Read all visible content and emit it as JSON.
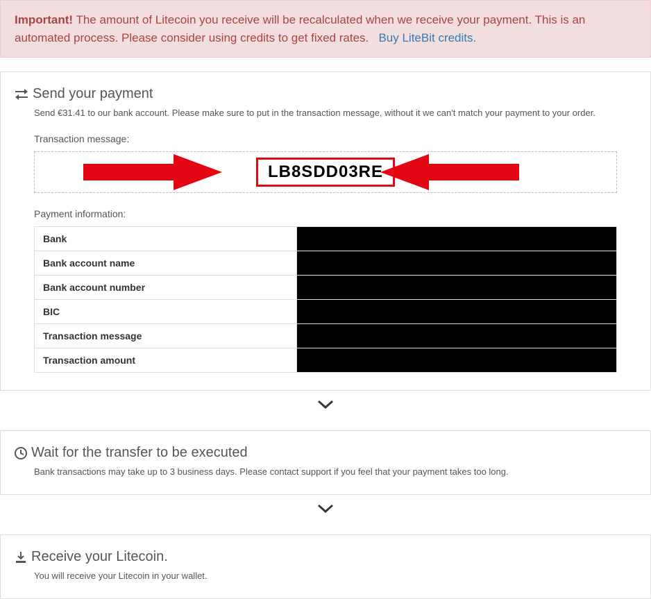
{
  "alert": {
    "strong": "Important!",
    "text": "The amount of Litecoin you receive will be recalculated when we receive your payment. This is an automated process. Please consider using credits to get fixed rates.",
    "link": "Buy LiteBit credits."
  },
  "section1": {
    "heading": "Send your payment",
    "sub": "Send €31.41 to our bank account. Please make sure to put in the transaction message, without it we can't match your payment to your order.",
    "txLabel": "Transaction message:",
    "txCode": "LB8SDD03RE",
    "payInfoLabel": "Payment information:",
    "rows": [
      {
        "key": "Bank",
        "val": ""
      },
      {
        "key": "Bank account name",
        "val": ""
      },
      {
        "key": "Bank account number",
        "val": ""
      },
      {
        "key": "BIC",
        "val": ""
      },
      {
        "key": "Transaction message",
        "val": ""
      },
      {
        "key": "Transaction amount",
        "val": ""
      }
    ]
  },
  "section2": {
    "heading": "Wait for the transfer to be executed",
    "sub": "Bank transactions may take up to 3 business days. Please contact support if you feel that your payment takes too long."
  },
  "section3": {
    "heading": "Receive your Litecoin.",
    "sub": "You will receive your Litecoin in your wallet."
  }
}
